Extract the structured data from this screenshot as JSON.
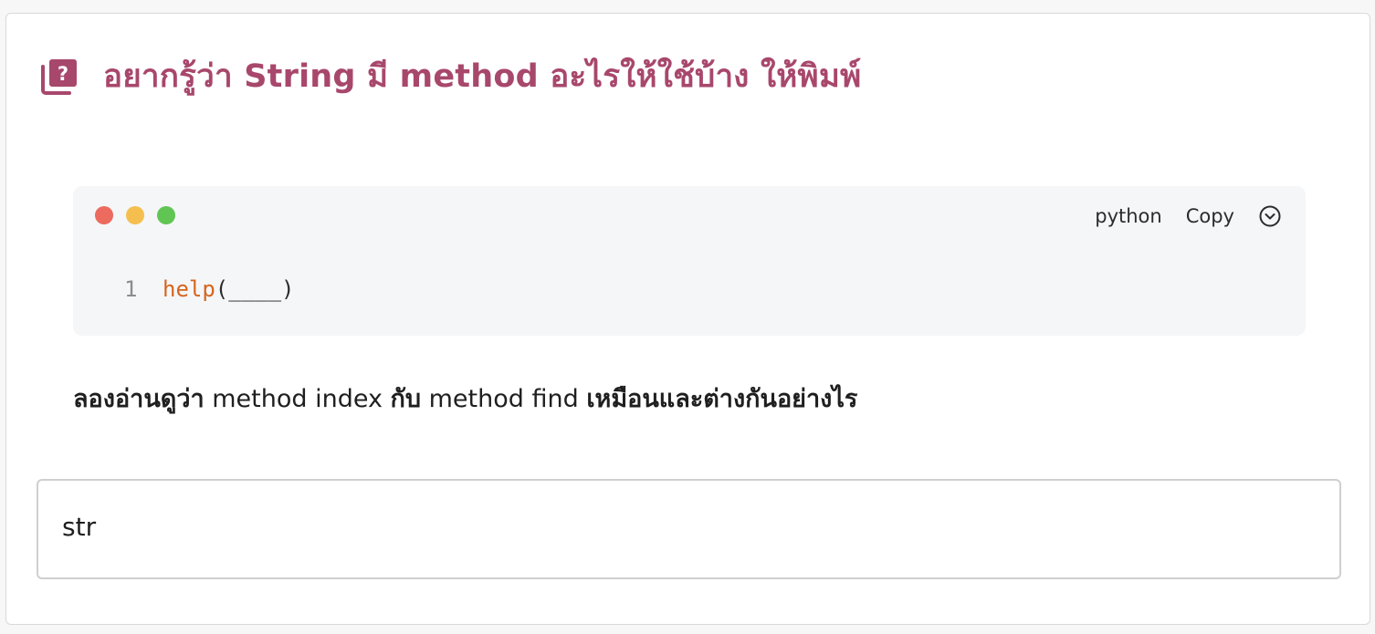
{
  "colors": {
    "accent": "#a8476c",
    "dot_red": "#ec6a5e",
    "dot_yellow": "#f4bf4f",
    "dot_green": "#61c554",
    "code_function": "#d4661f",
    "code_background": "#f5f6f8"
  },
  "header": {
    "icon": "book-question-icon",
    "title": "อยากรู้ว่า String มี method อะไรให้ใช้บ้าง ให้พิมพ์"
  },
  "code_block": {
    "language": "python",
    "copy_label": "Copy",
    "expand_icon": "chevron-down-circle-icon",
    "lines": [
      {
        "number": "1",
        "function": "help",
        "rest": "(____)"
      }
    ]
  },
  "prompt": {
    "part1": "ลองอ่านดูว่า",
    "part2": " method index ",
    "part3": "กับ",
    "part4": " method find ",
    "part5": "เหมือนและต่างกันอย่างไร"
  },
  "answer": {
    "value": "str"
  }
}
